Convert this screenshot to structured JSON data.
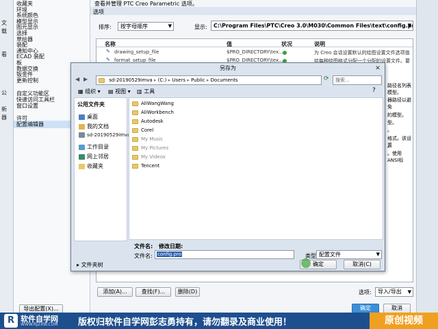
{
  "left_strip": [
    "文",
    "载",
    "看",
    "公",
    "新",
    "器"
  ],
  "nav_items": [
    "收藏夹",
    "环境",
    "系统颜色",
    "模型显示",
    "图元显示",
    "选择",
    "草绘器",
    "装配",
    "通知中心",
    "ECAD 装配",
    "板",
    "数据交换",
    "钣金件",
    "更新控制",
    "",
    "自定义功能区",
    "快速访问工具栏",
    "窗口设置",
    "",
    "许可",
    "配置编辑器"
  ],
  "nav_selected": "配置编辑器",
  "panel": {
    "description": "查看并管理 PTC Creo Parametric 选项。",
    "section_label": "选项",
    "sort_label": "排序:",
    "sort_value": "按字母顺序",
    "show_label": "显示:",
    "show_value": "C:\\Program Files\\PTC\\Creo 3.0\\M030\\Common Files\\text\\config.pro",
    "columns": [
      "名称",
      "值",
      "状况",
      "说明"
    ],
    "rows": [
      {
        "name": "drawing_setup_file",
        "value": "$PRO_DIRECTORY\\tex...",
        "desc": "为 Creo 会话设置默认的绘图设置文件选项值"
      },
      {
        "name": "format_setup_file",
        "value": "$PRO_DIRECTORY\\tex...",
        "desc": "给每种绘图格式分配一个分配的设置文件。要"
      }
    ],
    "right_fragments": [
      "路径名列表",
      "模型。",
      "器路径以避免",
      "的模型。",
      "型。",
      "。",
      "格式。该设置",
      "。",
      "。使用ANSI标"
    ],
    "add_button": "添加(A)...",
    "find_button": "查找(F)...",
    "delete_button": "删除(D)",
    "options_label": "选项:",
    "import_export": "导入/导出",
    "export_config": "导出配置(X)...",
    "ok": "确定",
    "cancel": "取消"
  },
  "dialog": {
    "title": "另存为",
    "breadcrumb": [
      "sd-20190529imva",
      "(C:)",
      "Users",
      "Public",
      "Documents"
    ],
    "search_placeholder": "搜索...",
    "toolbar": {
      "organize": "组织",
      "view": "视图",
      "tools": "工具"
    },
    "sidebar_title": "公用文件夹",
    "sidebar_items": [
      "桌面",
      "我的文档",
      "sd-20190529imva",
      "工作目录",
      "网上邻居",
      "收藏夹"
    ],
    "folders": [
      "AliWangWang",
      "AliWorkbench",
      "Autodesk",
      "Corel",
      "My Music",
      "My Pictures",
      "My Videos",
      "Tencent"
    ],
    "filename_col": "文件名:",
    "modified_col": "修改日期:",
    "filename_label": "文件名:",
    "filename_value": "config.pro",
    "type_label": "类型",
    "type_value": "配置文件",
    "folder_tree": "文件夹树",
    "ok": "确定",
    "cancel": "取消(C)"
  },
  "banner": {
    "site": "软件自学网",
    "url": "WWW.RJZXW.COM",
    "copyright": "版权归软件自学网彭志勇持有，请勿翻录及商业使用！",
    "original": "原创视频"
  },
  "colors": {
    "accent": "#1d4f8f",
    "status_ok": "#3aa23a",
    "orange": "#f0a020"
  }
}
